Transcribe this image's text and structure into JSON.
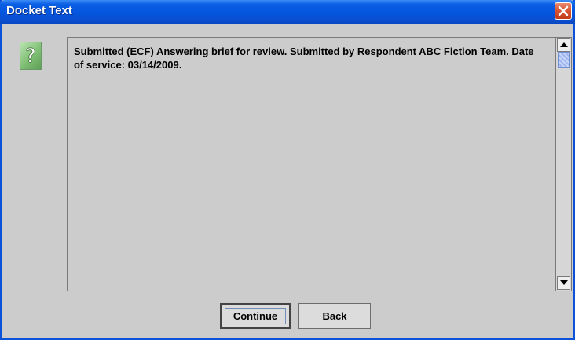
{
  "window": {
    "title": "Docket Text",
    "close_icon": "close-icon"
  },
  "message": {
    "icon": "question-icon",
    "text": "Submitted (ECF) Answering brief for review. Submitted by Respondent ABC Fiction Team. Date of service: 03/14/2009."
  },
  "buttons": {
    "continue_label": "Continue",
    "back_label": "Back"
  },
  "colors": {
    "titlebar": "#0355dd",
    "dialog_background": "#cccccc",
    "close_button": "#d8522f",
    "question_icon": "#7fbf74"
  }
}
